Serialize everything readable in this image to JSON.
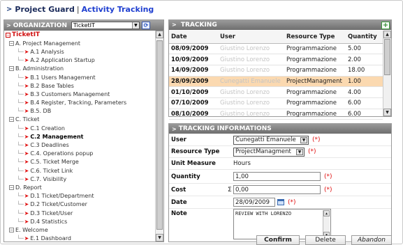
{
  "app": {
    "name": "Project Guard",
    "separator": "|",
    "page_title": "Activity Tracking"
  },
  "organization": {
    "header": "ORGANIZATION",
    "selected": "TicketIT",
    "tree": [
      {
        "label": "TicketIT",
        "kind": "root"
      },
      {
        "label": "A. Project Management",
        "kind": "group"
      },
      {
        "label": "A.1 Analysis",
        "kind": "leaf"
      },
      {
        "label": "A.2 Application Startup",
        "kind": "leaf"
      },
      {
        "label": "B. Administration",
        "kind": "group"
      },
      {
        "label": "B.1 Users Management",
        "kind": "leaf"
      },
      {
        "label": "B.2 Base Tables",
        "kind": "leaf"
      },
      {
        "label": "B.3 Customers Management",
        "kind": "leaf"
      },
      {
        "label": "B.4 Register, Tracking, Parameters",
        "kind": "leaf"
      },
      {
        "label": "B.5. DB",
        "kind": "leaf"
      },
      {
        "label": "C. Ticket",
        "kind": "group"
      },
      {
        "label": "C.1 Creation",
        "kind": "leaf"
      },
      {
        "label": "C.2 Management",
        "kind": "leaf",
        "active": true
      },
      {
        "label": "C.3 Deadlines",
        "kind": "leaf"
      },
      {
        "label": "C.4. Operations popup",
        "kind": "leaf"
      },
      {
        "label": "C.5. Ticket Merge",
        "kind": "leaf"
      },
      {
        "label": "C.6. Ticket Link",
        "kind": "leaf"
      },
      {
        "label": "C.7. Visibility",
        "kind": "leaf"
      },
      {
        "label": "D. Report",
        "kind": "group"
      },
      {
        "label": "D.1 Ticket/Department",
        "kind": "leaf"
      },
      {
        "label": "D.2 Ticket/Customer",
        "kind": "leaf"
      },
      {
        "label": "D.3 Ticket/User",
        "kind": "leaf"
      },
      {
        "label": "D.4 Statistics",
        "kind": "leaf"
      },
      {
        "label": "E. Welcome",
        "kind": "group"
      },
      {
        "label": "E.1 Dashboard",
        "kind": "leaf"
      }
    ]
  },
  "tracking": {
    "header": "TRACKING",
    "add_symbol": "+",
    "columns": [
      "Date",
      "User",
      "Resource Type",
      "Quantity"
    ],
    "rows": [
      {
        "date": "08/09/2009",
        "user": "Giustino Lorenzo",
        "resource": "Programmazione",
        "qty": "5.00"
      },
      {
        "date": "10/09/2009",
        "user": "Giustino Lorenzo",
        "resource": "Programmazione",
        "qty": "2.00"
      },
      {
        "date": "14/09/2009",
        "user": "Giustino Lorenzo",
        "resource": "Programmazione",
        "qty": "18.00"
      },
      {
        "date": "28/09/2009",
        "user": "Cunegatti Emanuele",
        "resource": "ProjectManagment",
        "qty": "1.00",
        "selected": true
      },
      {
        "date": "01/10/2009",
        "user": "Giustino Lorenzo",
        "resource": "Programmazione",
        "qty": "4.00"
      },
      {
        "date": "07/10/2009",
        "user": "Giustino Lorenzo",
        "resource": "Programmazione",
        "qty": "6.00"
      },
      {
        "date": "08/10/2009",
        "user": "Giustino Lorenzo",
        "resource": "Programmazione",
        "qty": "6.00"
      }
    ]
  },
  "info": {
    "header": "TRACKING INFORMATIONS",
    "required_mark": "(*)",
    "sigma": "Σ",
    "user_label": "User",
    "user_value": "Cunegatti Emanuele",
    "resource_label": "Resource Type",
    "resource_value": "ProjectManagment",
    "unit_label": "Unit Measure",
    "unit_value": "Hours",
    "quantity_label": "Quantity",
    "quantity_value": "1,00",
    "cost_label": "Cost",
    "cost_value": "0,00",
    "date_label": "Date",
    "date_value": "28/09/2009",
    "note_label": "Note",
    "note_value": "REVIEW WITH LORENZO"
  },
  "buttons": {
    "confirm": "Confirm",
    "delete": "Delete",
    "abandon": "Abandon"
  }
}
